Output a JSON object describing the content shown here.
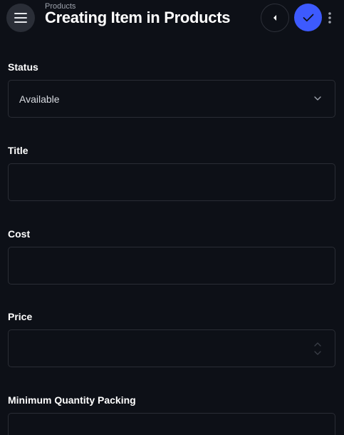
{
  "header": {
    "breadcrumb": "Products",
    "title": "Creating Item in Products",
    "icons": {
      "menu": "menu-icon",
      "back": "caret-left-icon",
      "save": "check-icon",
      "more": "more-vertical-icon"
    }
  },
  "colors": {
    "background": "#0d1017",
    "accent": "#3d5afe",
    "border": "#2a2d35"
  },
  "form": {
    "fields": [
      {
        "label": "Status",
        "type": "select",
        "value": "Available"
      },
      {
        "label": "Title",
        "type": "text",
        "value": ""
      },
      {
        "label": "Cost",
        "type": "text",
        "value": ""
      },
      {
        "label": "Price",
        "type": "number",
        "value": ""
      },
      {
        "label": "Minimum Quantity Packing",
        "type": "text",
        "value": ""
      }
    ]
  }
}
